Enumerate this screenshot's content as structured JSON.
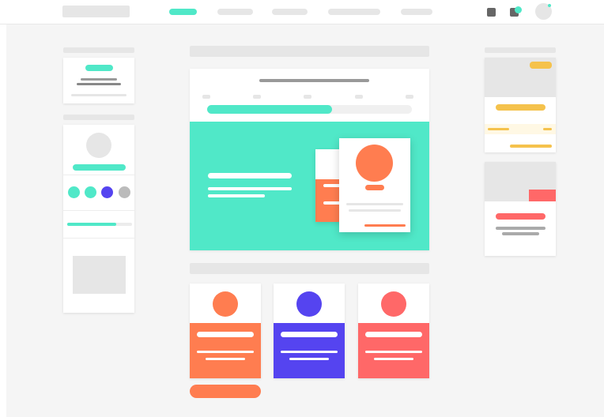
{
  "colors": {
    "accent_teal": "#50e8c8",
    "orange": "#ff7d50",
    "purple": "#5544f0",
    "coral": "#ff6868",
    "yellow": "#f5c24c",
    "placeholder_gray": "#e6e6e6",
    "page_bg": "#f5f5f5"
  },
  "header": {
    "logo_icon": "logo-placeholder",
    "nav_items": [
      {
        "name": "nav-item-1",
        "active": true
      },
      {
        "name": "nav-item-2",
        "active": false
      },
      {
        "name": "nav-item-3",
        "active": false
      },
      {
        "name": "nav-item-4",
        "active": false
      },
      {
        "name": "nav-item-5",
        "active": false
      }
    ],
    "icons": [
      "square-icon",
      "notification-icon",
      "avatar"
    ]
  },
  "main": {
    "hero": {
      "step_count": 5,
      "progress": 0.6
    },
    "cards": [
      {
        "color": "orange"
      },
      {
        "color": "purple"
      },
      {
        "color": "coral"
      }
    ],
    "cta_color": "orange"
  },
  "left_sidebar": {
    "color_swatches": [
      "#50e8c8",
      "#50e8c8",
      "#5544f0",
      "#bbbbbb"
    ],
    "slider_level": 0.75
  }
}
